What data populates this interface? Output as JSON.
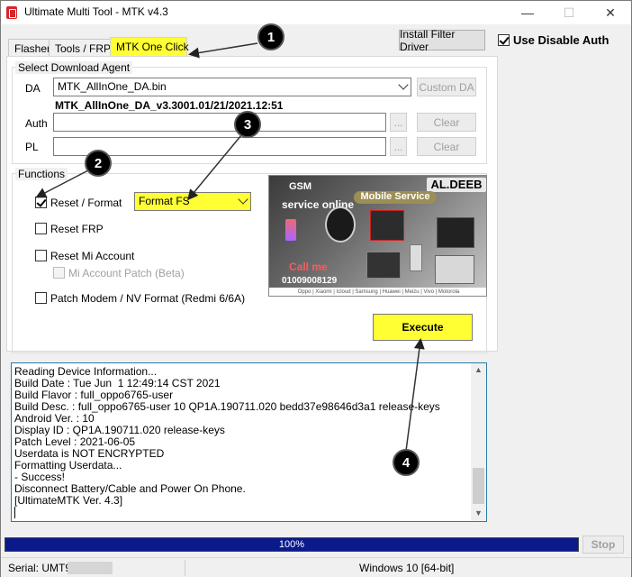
{
  "window": {
    "title": "Ultimate Multi Tool - MTK v4.3",
    "controls": {
      "minimize": "—",
      "maximize": "☐",
      "close": "✕"
    }
  },
  "tabs": [
    {
      "label": "Flasher"
    },
    {
      "label": "Tools / FRP"
    },
    {
      "label": "MTK One Click"
    }
  ],
  "toolbar": {
    "install_filter_driver": "Install Filter Driver",
    "use_disable_auth": "Use Disable Auth",
    "use_disable_auth_checked": true
  },
  "download_agent": {
    "legend": "Select Download Agent",
    "da_label": "DA",
    "da_value": "MTK_AllInOne_DA.bin",
    "custom_da": "Custom DA",
    "da_info": "MTK_AllInOne_DA_v3.3001.01/21/2021.12:51",
    "auth_label": "Auth",
    "pl_label": "PL",
    "browse": "...",
    "clear": "Clear"
  },
  "functions": {
    "legend": "Functions",
    "reset_format": {
      "label": "Reset / Format",
      "checked": true
    },
    "format_mode": "Format FS",
    "reset_frp": {
      "label": "Reset FRP",
      "checked": false
    },
    "reset_mi_account": {
      "label": "Reset Mi Account",
      "checked": false
    },
    "mi_account_patch": {
      "label": "Mi Account Patch (Beta)",
      "checked": false
    },
    "patch_modem": {
      "label": "Patch Modem / NV Format (Redmi 6/6A)",
      "checked": false
    },
    "execute": "Execute"
  },
  "ad": {
    "brand": "AL.DEEB",
    "gsm": "GSM",
    "service_online": "service online",
    "mobile_service": "Mobile Service",
    "call_me": "Call me",
    "phone": "01009008129",
    "footer": "Oppo | Xiaomi | Icloud | Samsung | Huawei | Meizu | Vivo | Motorola"
  },
  "log": [
    "Reading Device Information...",
    "Build Date : Tue Jun  1 12:49:14 CST 2021",
    "Build Flavor : full_oppo6765-user",
    "Build Desc. : full_oppo6765-user 10 QP1A.190711.020 bedd37e98646d3a1 release-keys",
    "Android Ver. : 10",
    "Display ID : QP1A.190711.020 release-keys",
    "Patch Level : 2021-06-05",
    "Userdata is NOT ENCRYPTED",
    "Formatting Userdata...",
    "- Success!",
    "Disconnect Battery/Cable and Power On Phone.",
    "[UltimateMTK Ver. 4.3]"
  ],
  "progress": {
    "text": "100%",
    "value": 1.0
  },
  "stop": "Stop",
  "status": {
    "serial": "Serial: UMT9",
    "os": "Windows 10 [64-bit]"
  },
  "callouts": [
    "1",
    "2",
    "3",
    "4"
  ],
  "colors": {
    "highlight": "#ffff33",
    "progress": "#0a1a8c",
    "log_border": "#2a7aa8"
  }
}
